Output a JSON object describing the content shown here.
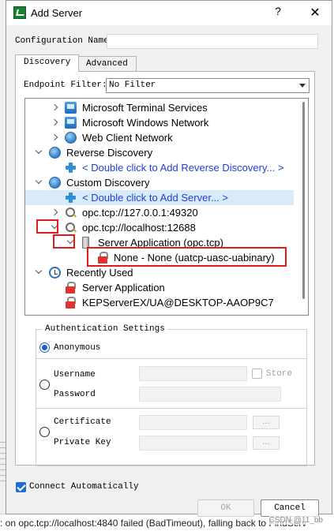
{
  "window": {
    "title": "Add Server",
    "help_label": "?",
    "close_label": "✕"
  },
  "config": {
    "label": "Configuration Name",
    "value": ""
  },
  "tabs": [
    {
      "label": "Discovery",
      "active": true
    },
    {
      "label": "Advanced",
      "active": false
    }
  ],
  "endpoint_filter": {
    "label": "Endpoint Filter:",
    "selected": "No Filter"
  },
  "tree": {
    "rows": [
      {
        "label": "Microsoft Terminal Services",
        "icon": "windows-icon",
        "expander": "collapsed",
        "level": 2
      },
      {
        "label": "Microsoft Windows Network",
        "icon": "windows-icon",
        "expander": "collapsed",
        "level": 2
      },
      {
        "label": "Web Client Network",
        "icon": "globe-icon",
        "expander": "collapsed",
        "level": 2
      },
      {
        "label": "Reverse Discovery",
        "icon": "globe-icon",
        "expander": "expanded",
        "level": 1
      },
      {
        "label": "< Double click to Add Reverse Discovery... >",
        "icon": "add-icon",
        "level": 2,
        "link": true
      },
      {
        "label": "Custom Discovery",
        "icon": "globe-icon",
        "expander": "expanded",
        "level": 1
      },
      {
        "label": "< Double click to Add Server... >",
        "icon": "add-icon",
        "level": 2,
        "link": true,
        "selected": true
      },
      {
        "label": "opc.tcp://127.0.0.1:49320",
        "icon": "search-icon",
        "expander": "collapsed",
        "level": 2
      },
      {
        "label": "opc.tcp://localhost:12688",
        "icon": "search-icon",
        "expander": "expanded",
        "level": 2
      },
      {
        "label": "Server Application (opc.tcp)",
        "icon": "server-icon",
        "expander": "expanded",
        "level": 3
      },
      {
        "label": "None - None (uatcp-uasc-uabinary)",
        "icon": "lock-icon",
        "level": 4
      },
      {
        "label": "Recently Used",
        "icon": "clock-icon",
        "expander": "expanded",
        "level": 1
      },
      {
        "label": "Server Application",
        "icon": "lock-icon",
        "level": 2
      },
      {
        "label": "KEPServerEX/UA@DESKTOP-AAOP9C7",
        "icon": "lock-icon",
        "level": 2
      }
    ]
  },
  "auth": {
    "title": "Authentication Settings",
    "anonymous_label": "Anonymous",
    "username_label": "Username",
    "password_label": "Password",
    "store_label": "Store",
    "certificate_label": "Certificate",
    "private_key_label": "Private Key",
    "browse_label": "...",
    "selected_mode": "anonymous"
  },
  "connect_auto": {
    "label": "Connect Automatically",
    "checked": true
  },
  "buttons": {
    "ok": "OK",
    "cancel": "Cancel"
  },
  "background": {
    "log_text": ": on opc.tcp://localhost:4840 failed (BadTimeout), falling back to FindServ",
    "watermark": "CSDN @11_bb"
  },
  "colors": {
    "link": "#1f3fd6",
    "highlight_box": "#e01b1b",
    "selection": "#d7ebfb",
    "accent": "#1a5fc4"
  }
}
